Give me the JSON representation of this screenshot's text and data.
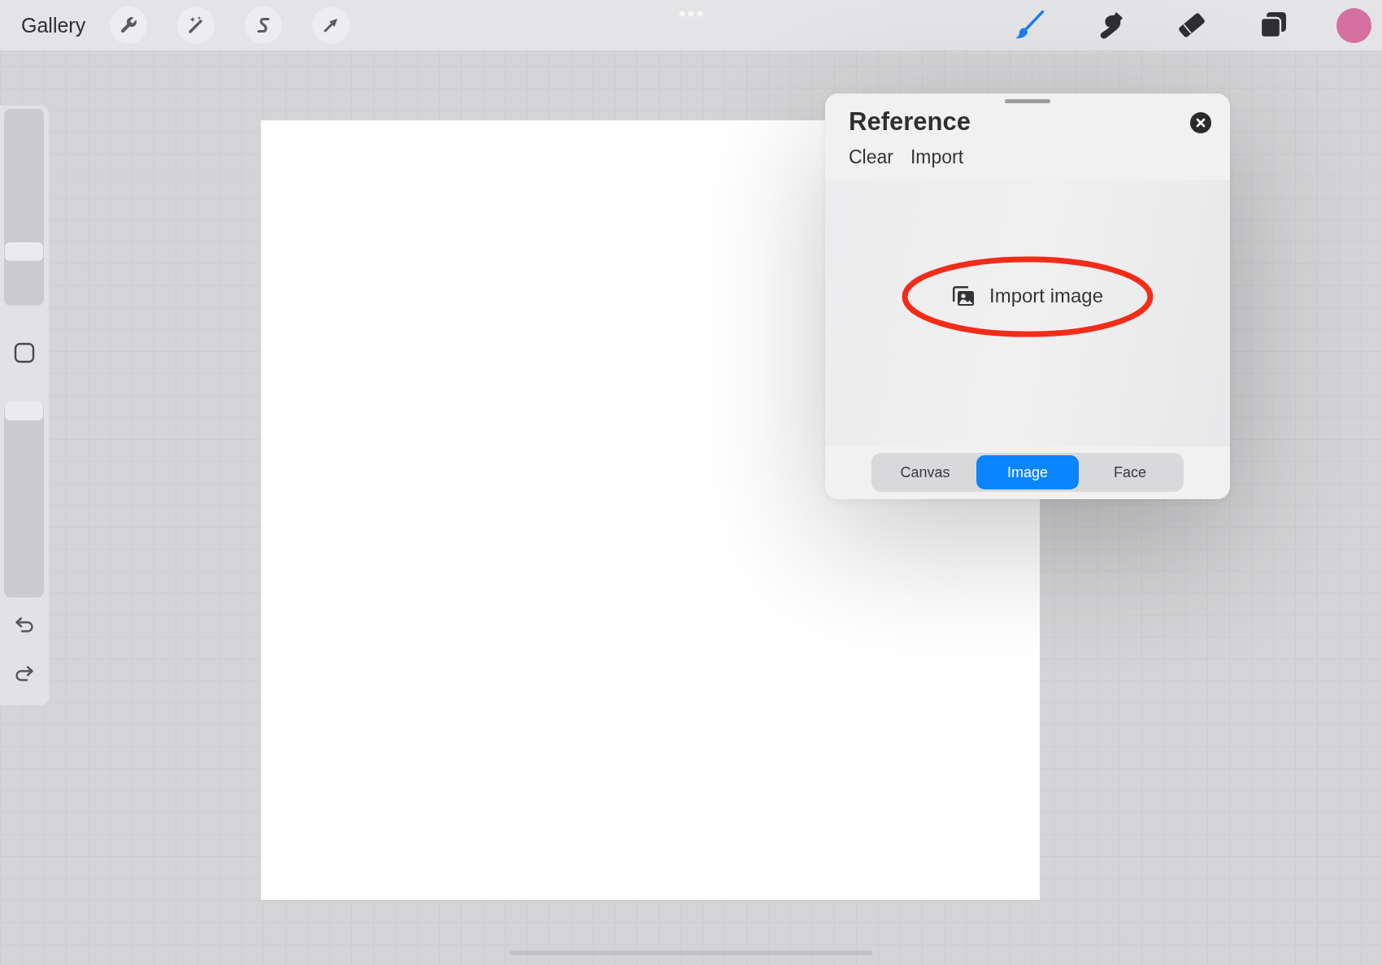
{
  "toolbar": {
    "gallery_label": "Gallery",
    "tools": [
      {
        "kind": "brush",
        "selected": true
      },
      {
        "kind": "smudge",
        "selected": false
      },
      {
        "kind": "eraser",
        "selected": false
      }
    ],
    "color_swatch": {
      "color": "#d46f9f"
    }
  },
  "sidebar": {
    "sliders": [
      {
        "level": 0.25
      },
      {
        "level": 1
      }
    ]
  },
  "reference": {
    "title": "Reference",
    "actions": [
      "Clear",
      "Import"
    ],
    "import_button": {
      "label": "Import image",
      "highlighted": true
    },
    "tabs": [
      {
        "label": "Canvas",
        "selected": false
      },
      {
        "label": "Image",
        "selected": true
      },
      {
        "label": "Face",
        "selected": false
      }
    ]
  }
}
